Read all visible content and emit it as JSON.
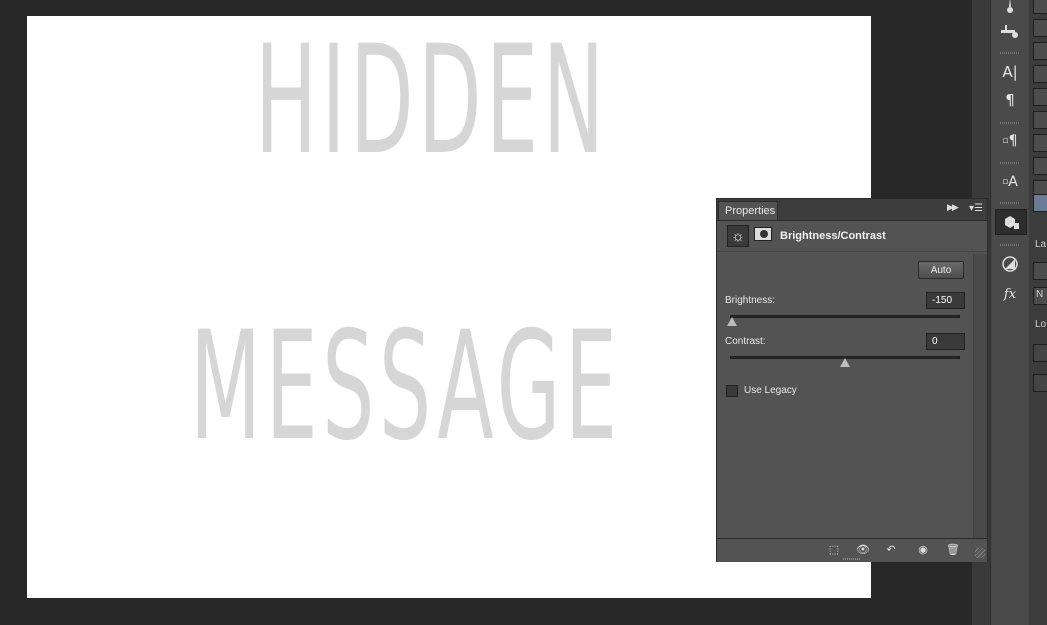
{
  "canvas": {
    "line1": "HIDDEN",
    "line2": "MESSAGE"
  },
  "properties_panel": {
    "tab_label": "Properties",
    "adjustment_title": "Brightness/Contrast",
    "auto_label": "Auto",
    "brightness": {
      "label": "Brightness:",
      "value": "-150",
      "slider_fraction": 0.0
    },
    "contrast": {
      "label": "Contrast:",
      "value": "0",
      "slider_fraction": 0.5
    },
    "use_legacy": {
      "label": "Use Legacy",
      "checked": false
    }
  },
  "right_dock": {
    "tools": [
      "brush-presets-icon",
      "tool-presets-icon",
      "character-icon",
      "paragraph-icon",
      "paragraph-styles-icon",
      "character-styles-icon",
      "properties-icon",
      "adjustments-icon",
      "styles-fx-icon"
    ],
    "partial_labels": {
      "layers_tab": "La",
      "lock_label": "Lo",
      "blend_mode": "N"
    }
  },
  "colors": {
    "app_background": "#282828",
    "panel_background": "#535353",
    "canvas_text": "#d6d6d6",
    "selected_row": "#6b7b95"
  }
}
